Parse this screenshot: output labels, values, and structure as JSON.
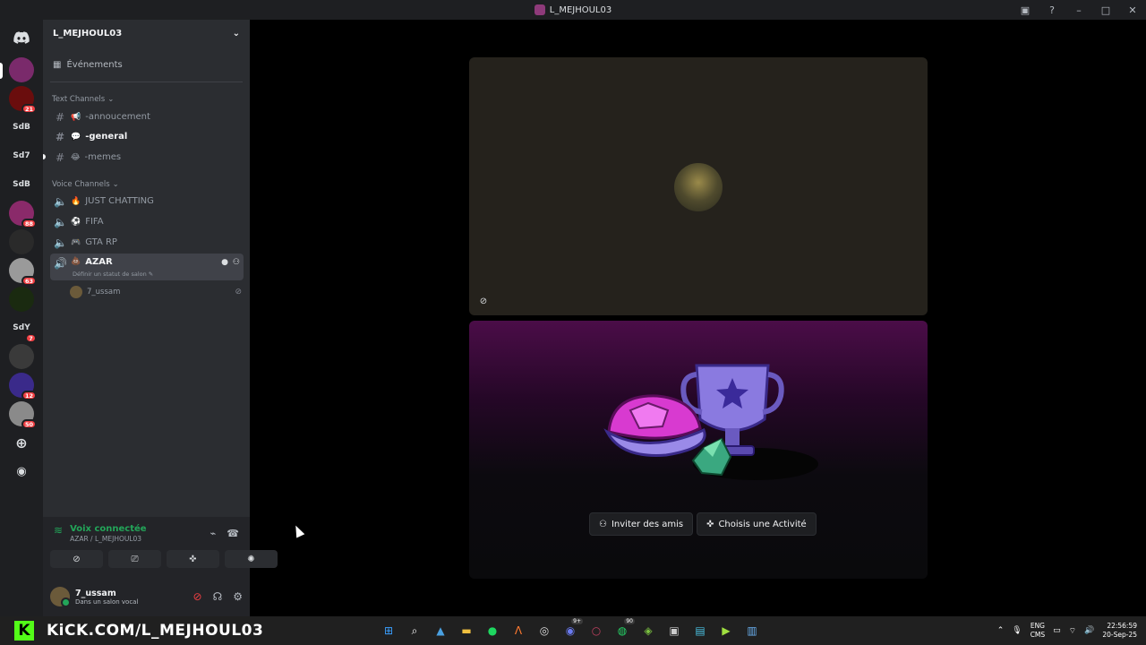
{
  "window": {
    "title": "L_MEJHOUL03"
  },
  "servers": [
    {
      "kind": "home",
      "icon": "discord-logo-icon",
      "label": ""
    },
    {
      "kind": "image",
      "badge": "",
      "color": "#7a2a6b"
    },
    {
      "kind": "image",
      "badge": "21",
      "color": "#6a0d0d"
    },
    {
      "kind": "text",
      "label": "SdB"
    },
    {
      "kind": "text",
      "label": "Sd7"
    },
    {
      "kind": "text",
      "label": "SdB"
    },
    {
      "kind": "image",
      "badge": "88",
      "color": "#8a2a6a"
    },
    {
      "kind": "image",
      "badge": "",
      "color": "#2a2a2a"
    },
    {
      "kind": "image",
      "badge": "63",
      "color": "#9a9a9a"
    },
    {
      "kind": "image",
      "badge": "",
      "color": "#1a2a10"
    },
    {
      "kind": "text",
      "label": "SdY",
      "badge": "7"
    },
    {
      "kind": "image",
      "badge": "",
      "color": "#3a3a3a"
    },
    {
      "kind": "image",
      "badge": "12",
      "color": "#3a2a8a"
    },
    {
      "kind": "image",
      "badge": "50",
      "color": "#8a8a8a"
    }
  ],
  "guild": {
    "name": "L_MEJHOUL03",
    "events_label": "Événements",
    "text_category": "Text Channels",
    "voice_category": "Voice Channels",
    "text_channels": [
      {
        "emoji": "📢",
        "name": "-annoucement"
      },
      {
        "emoji": "💬",
        "name": "-general"
      },
      {
        "emoji": "😂",
        "name": "-memes"
      }
    ],
    "voice_channels": [
      {
        "emoji": "🔥",
        "name": "JUST CHATTING"
      },
      {
        "emoji": "⚽",
        "name": "FIFA"
      },
      {
        "emoji": "🎮",
        "name": "GTA RP"
      },
      {
        "emoji": "💩",
        "name": "AZAR",
        "status_hint": "Définir un statut de salon ✎"
      }
    ],
    "voice_member": "7_ussam"
  },
  "voice_panel": {
    "status": "Voix connectée",
    "location": "AZAR / L_MEJHOUL03",
    "user_name": "7_ussam",
    "user_status": "Dans un salon vocal"
  },
  "activity": {
    "invite_label": "Inviter des amis",
    "choose_label": "Choisis une Activité"
  },
  "taskbar": {
    "kick_letter": "K",
    "kick_url": "KiCK.COM/L_MEJHOUL03",
    "lang_top": "ENG",
    "lang_bottom": "CMS",
    "time": "22:56:59",
    "date": "20-Sep-25",
    "whatsapp_count": "90",
    "discord_count": "9+"
  }
}
